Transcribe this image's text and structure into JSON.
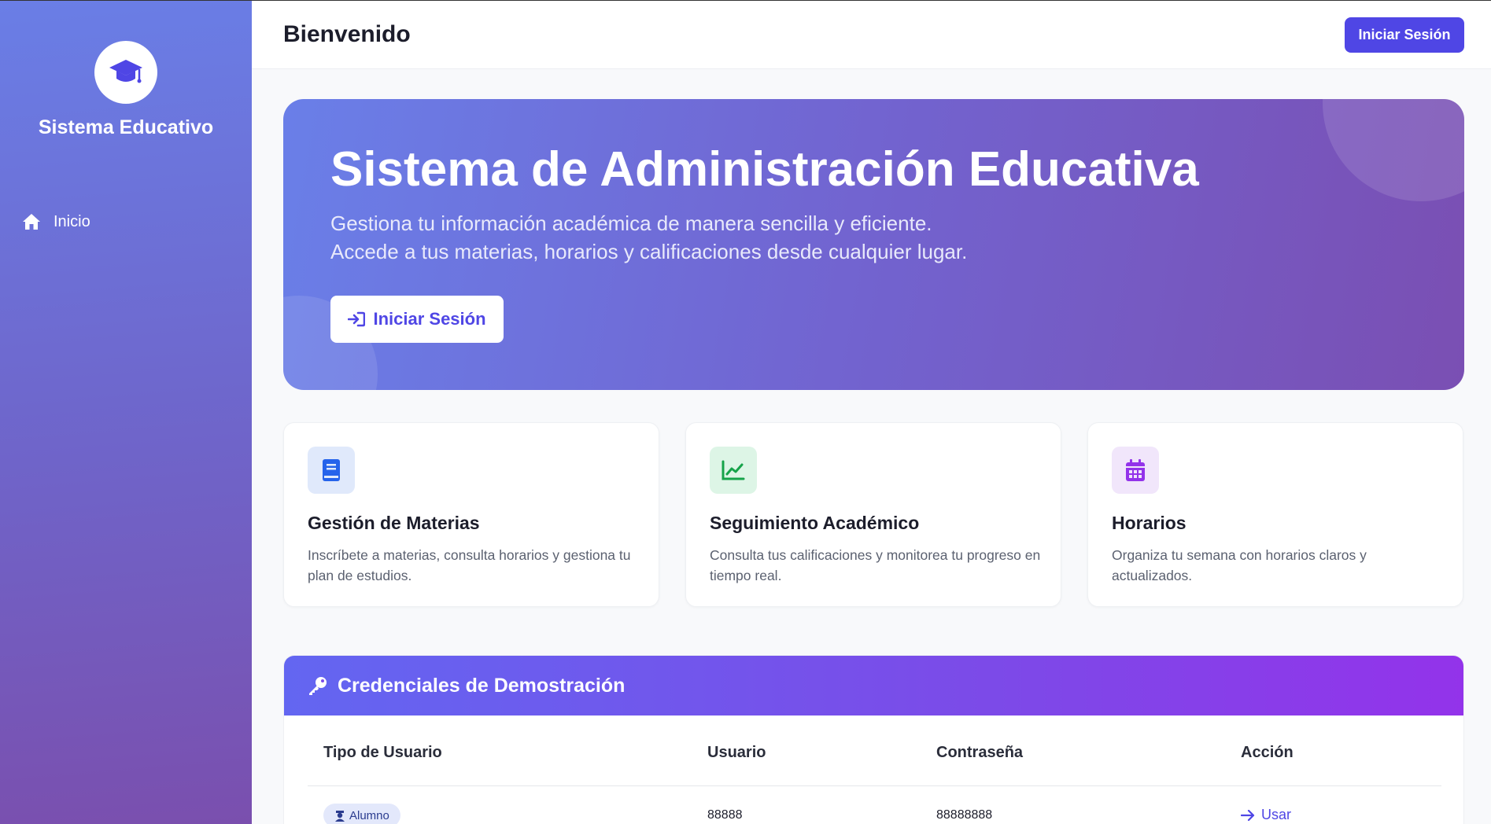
{
  "sidebar": {
    "brand_icon": "graduation-cap-icon",
    "brand_title": "Sistema Educativo",
    "items": [
      {
        "icon": "home-icon",
        "label": "Inicio"
      }
    ]
  },
  "header": {
    "title": "Bienvenido",
    "login_button": "Iniciar Sesión"
  },
  "hero": {
    "title": "Sistema de Administración Educativa",
    "subtitle_line1": "Gestiona tu información académica de manera sencilla y eficiente.",
    "subtitle_line2": "Accede a tus materias, horarios y calificaciones desde cualquier lugar.",
    "button_icon": "sign-in-icon",
    "button_label": "Iniciar Sesión"
  },
  "features": [
    {
      "icon": "book-icon",
      "title": "Gestión de Materias",
      "description": "Inscríbete a materias, consulta horarios y gestiona tu plan de estudios.",
      "accent": "#2563eb",
      "accent_bg": "#e0e9fb"
    },
    {
      "icon": "chart-line-icon",
      "title": "Seguimiento Académico",
      "description": "Consulta tus calificaciones y monitorea tu progreso en tiempo real.",
      "accent": "#16a34a",
      "accent_bg": "#ddf5e6"
    },
    {
      "icon": "calendar-icon",
      "title": "Horarios",
      "description": "Organiza tu semana con horarios claros y actualizados.",
      "accent": "#9333ea",
      "accent_bg": "#f1e6fb"
    }
  ],
  "credentials": {
    "icon": "key-icon",
    "title": "Credenciales de Demostración",
    "headers": [
      "Tipo de Usuario",
      "Usuario",
      "Contraseña",
      "Acción"
    ],
    "rows": [
      {
        "type": "Alumno",
        "type_icon": "student-icon",
        "user": "88888",
        "password": "88888888",
        "action_icon": "arrow-right-icon",
        "action": "Usar"
      }
    ]
  },
  "colors": {
    "primary": "#4f46e5",
    "sidebar_gradient_start": "#6a7ee6",
    "sidebar_gradient_end": "#7a4fae"
  }
}
